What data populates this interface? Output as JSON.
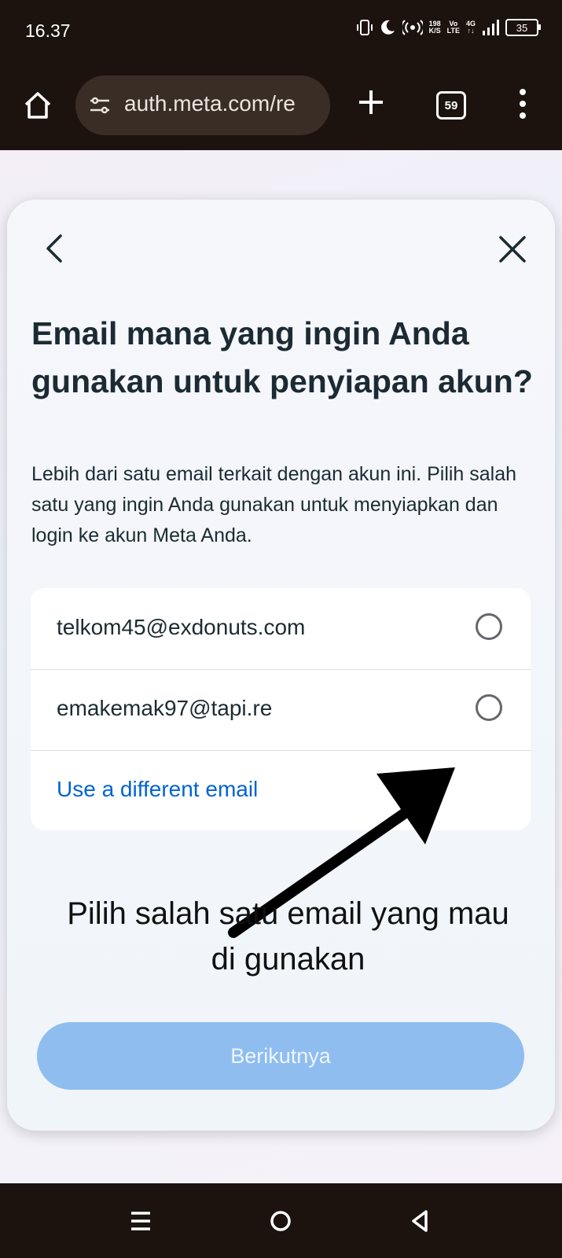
{
  "status_bar": {
    "time": "16.37",
    "net_speed_top": "198",
    "net_speed_unit": "K/S",
    "volte_top": "Vo",
    "volte_bottom": "LTE",
    "network_top": "4G",
    "network_bottom": "↑↓",
    "battery": "35"
  },
  "browser": {
    "url": "auth.meta.com/re",
    "tab_count": "59"
  },
  "dialog": {
    "title": "Email mana yang ingin Anda gunakan untuk penyiapan akun?",
    "description": "Lebih dari satu email terkait dengan akun ini. Pilih salah satu yang ingin Anda gunakan untuk menyiapkan dan login ke akun Meta Anda.",
    "options": [
      {
        "email": "telkom45@exdonuts.com",
        "selected": false
      },
      {
        "email": "emakemak97@tapi.re",
        "selected": false
      }
    ],
    "different_email_link": "Use a different email",
    "next_button": "Berikutnya"
  },
  "annotation": {
    "line1": "Pilih salah satu email yang mau",
    "line2": "di gunakan"
  },
  "colors": {
    "chrome_bg": "#1c130f",
    "link": "#0064d1",
    "button_disabled": "#8fbdf0",
    "text_primary": "#1c2b33"
  }
}
